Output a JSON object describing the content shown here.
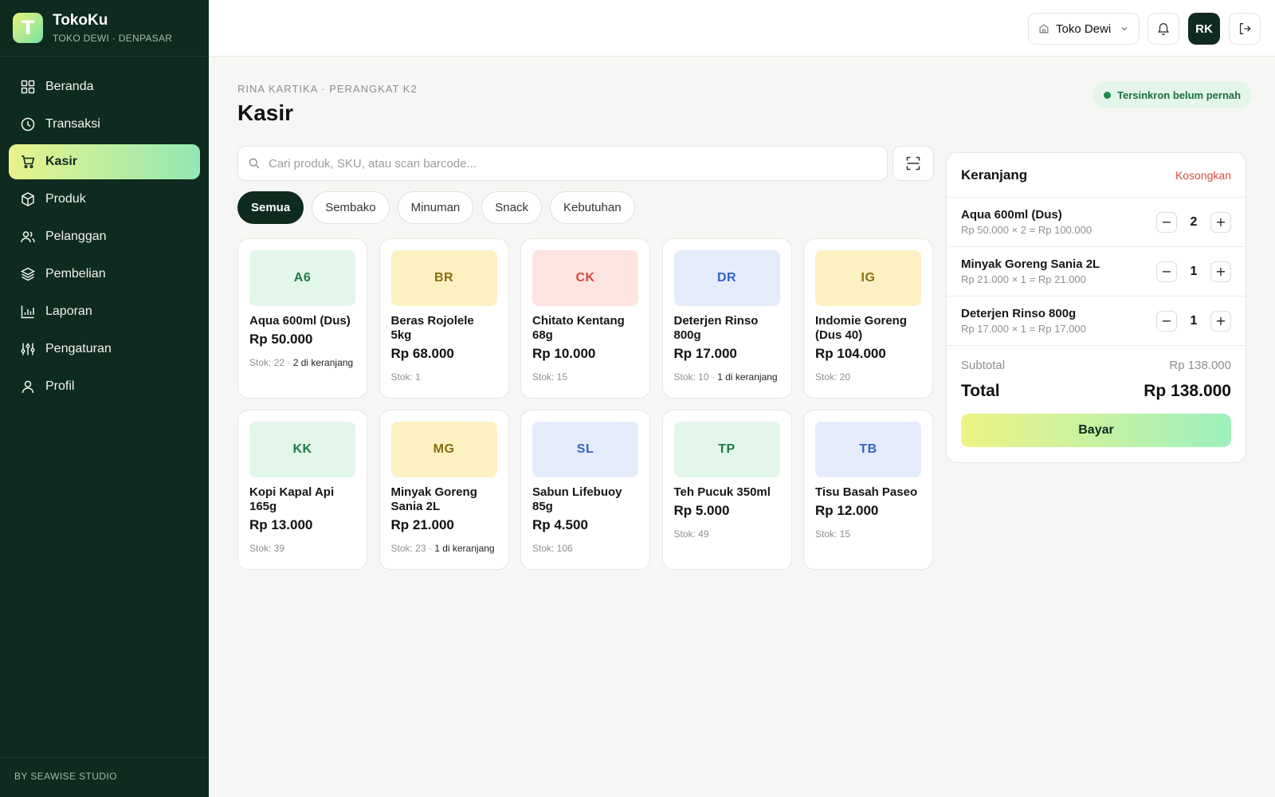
{
  "brand": {
    "name": "TokoKu",
    "subtitle": "TOKO DEWI · DENPASAR",
    "logo_letter": "T"
  },
  "sidebar": {
    "items": [
      {
        "label": "Beranda",
        "icon": "grid-icon"
      },
      {
        "label": "Transaksi",
        "icon": "clock-icon"
      },
      {
        "label": "Kasir",
        "icon": "cart-icon",
        "active": true
      },
      {
        "label": "Produk",
        "icon": "box-icon"
      },
      {
        "label": "Pelanggan",
        "icon": "users-icon"
      },
      {
        "label": "Pembelian",
        "icon": "layers-icon"
      },
      {
        "label": "Laporan",
        "icon": "bar-chart-icon"
      },
      {
        "label": "Pengaturan",
        "icon": "sliders-icon"
      },
      {
        "label": "Profil",
        "icon": "user-icon"
      }
    ],
    "footer": "BY SEAWISE STUDIO"
  },
  "topbar": {
    "store": "Toko Dewi",
    "avatar": "RK"
  },
  "page": {
    "breadcrumb": "RINA KARTIKA · PERANGKAT K2",
    "title": "Kasir",
    "sync_status": "Tersinkron belum pernah"
  },
  "search": {
    "placeholder": "Cari produk, SKU, atau scan barcode..."
  },
  "categories": [
    "Semua",
    "Sembako",
    "Minuman",
    "Snack",
    "Kebutuhan"
  ],
  "products": [
    {
      "code": "A6",
      "name": "Aqua 600ml (Dus)",
      "price": "Rp 50.000",
      "stock": "Stok: 22",
      "in_cart": "2 di keranjang",
      "bg": "#e3f6ea",
      "fg": "#1f7a45"
    },
    {
      "code": "BR",
      "name": "Beras Rojolele 5kg",
      "price": "Rp 68.000",
      "stock": "Stok: 1",
      "in_cart": "",
      "bg": "#fdf1c4",
      "fg": "#8a6d10"
    },
    {
      "code": "CK",
      "name": "Chitato Kentang 68g",
      "price": "Rp 10.000",
      "stock": "Stok: 15",
      "in_cart": "",
      "bg": "#fde4e1",
      "fg": "#d8493a"
    },
    {
      "code": "DR",
      "name": "Deterjen Rinso 800g",
      "price": "Rp 17.000",
      "stock": "Stok: 10",
      "in_cart": "1 di keranjang",
      "bg": "#e4ecfb",
      "fg": "#3561c6"
    },
    {
      "code": "IG",
      "name": "Indomie Goreng (Dus 40)",
      "price": "Rp 104.000",
      "stock": "Stok: 20",
      "in_cart": "",
      "bg": "#fdf1c4",
      "fg": "#8a6d10"
    },
    {
      "code": "KK",
      "name": "Kopi Kapal Api 165g",
      "price": "Rp 13.000",
      "stock": "Stok: 39",
      "in_cart": "",
      "bg": "#e3f6ea",
      "fg": "#1f7a45"
    },
    {
      "code": "MG",
      "name": "Minyak Goreng Sania 2L",
      "price": "Rp 21.000",
      "stock": "Stok: 23",
      "in_cart": "1 di keranjang",
      "bg": "#fdf1c4",
      "fg": "#8a6d10"
    },
    {
      "code": "SL",
      "name": "Sabun Lifebuoy 85g",
      "price": "Rp 4.500",
      "stock": "Stok: 106",
      "in_cart": "",
      "bg": "#e4ecfb",
      "fg": "#3561c6"
    },
    {
      "code": "TP",
      "name": "Teh Pucuk 350ml",
      "price": "Rp 5.000",
      "stock": "Stok: 49",
      "in_cart": "",
      "bg": "#e3f6ea",
      "fg": "#1f7a45"
    },
    {
      "code": "TB",
      "name": "Tisu Basah Paseo",
      "price": "Rp 12.000",
      "stock": "Stok: 15",
      "in_cart": "",
      "bg": "#e4ecfb",
      "fg": "#3561c6"
    }
  ],
  "cart": {
    "title": "Keranjang",
    "clear_label": "Kosongkan",
    "items": [
      {
        "name": "Aqua 600ml (Dus)",
        "calc": "Rp 50.000 × 2 = Rp 100.000",
        "qty": "2"
      },
      {
        "name": "Minyak Goreng Sania 2L",
        "calc": "Rp 21.000 × 1 = Rp 21.000",
        "qty": "1"
      },
      {
        "name": "Deterjen Rinso 800g",
        "calc": "Rp 17.000 × 1 = Rp 17.000",
        "qty": "1"
      }
    ],
    "subtotal_label": "Subtotal",
    "subtotal": "Rp 138.000",
    "total_label": "Total",
    "total": "Rp 138.000",
    "pay_label": "Bayar"
  }
}
